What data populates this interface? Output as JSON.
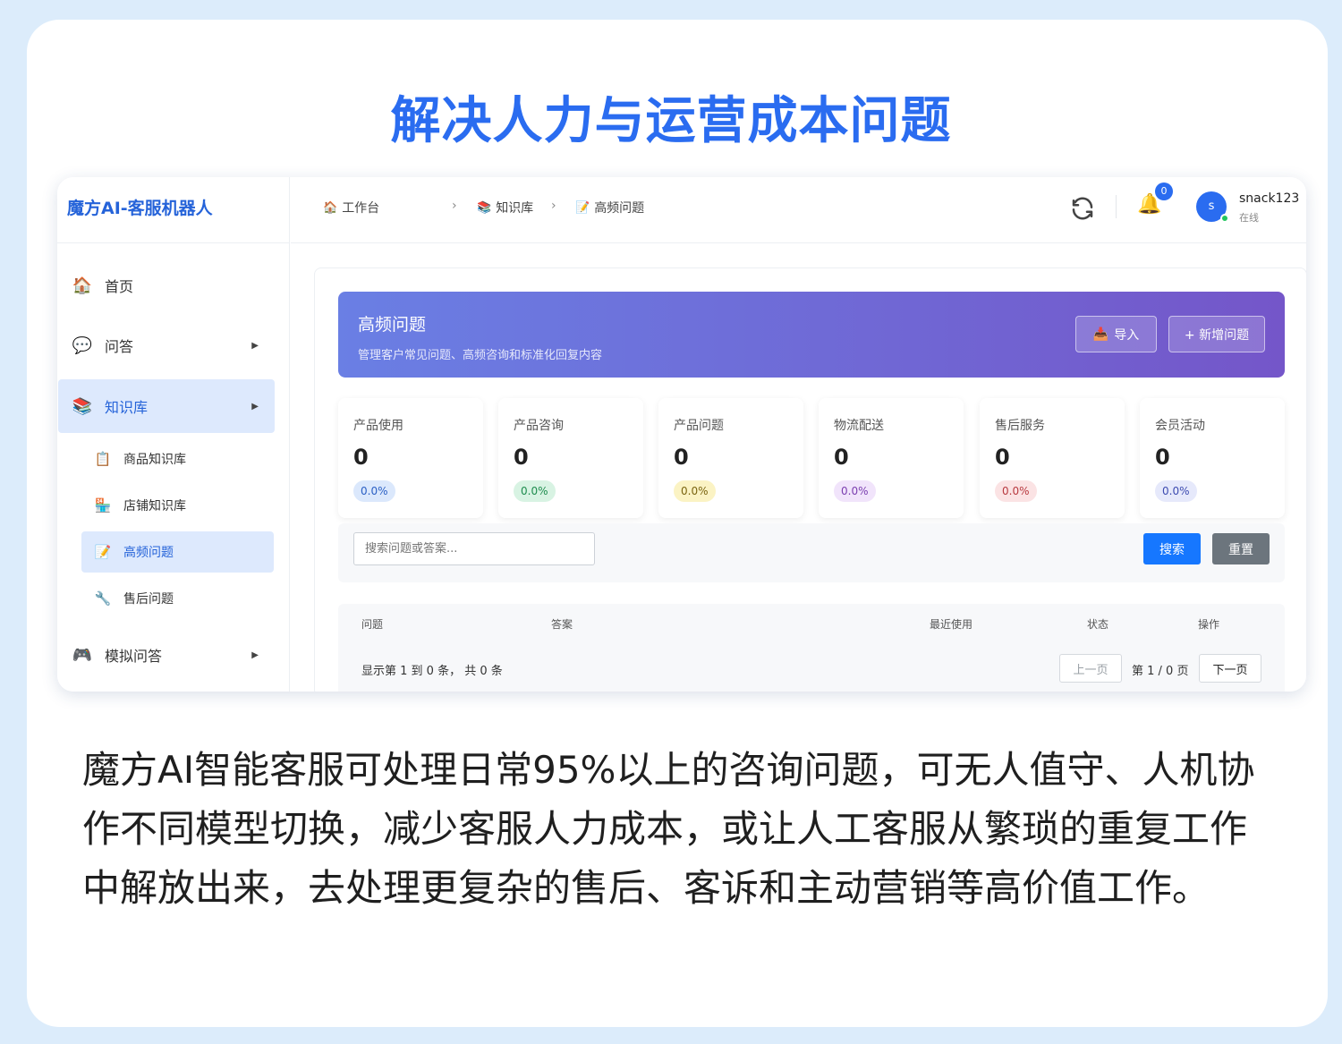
{
  "headline": "解决人力与运营成本问题",
  "app": {
    "brand": "魔方AI-客服机器人",
    "sidebar": {
      "items": [
        {
          "icon": "🏠",
          "label": "首页",
          "arrow": ""
        },
        {
          "icon": "💬",
          "label": "问答",
          "arrow": "▶"
        },
        {
          "icon": "📚",
          "label": "知识库",
          "arrow": "▶"
        },
        {
          "icon": "🎮",
          "label": "模拟问答",
          "arrow": "▶"
        }
      ],
      "sub_items": [
        {
          "icon": "📋",
          "label": "商品知识库"
        },
        {
          "icon": "🏪",
          "label": "店铺知识库"
        },
        {
          "icon": "📝",
          "label": "高频问题"
        },
        {
          "icon": "🔧",
          "label": "售后问题"
        }
      ]
    },
    "topbar": {
      "breadcrumb": [
        {
          "icon": "🏠",
          "label": "工作台"
        },
        {
          "icon": "📚",
          "label": "知识库"
        },
        {
          "icon": "📝",
          "label": "高频问题"
        }
      ],
      "separator": "›",
      "notification_count": "0",
      "bell_icon": "🔔",
      "user": {
        "initial": "s",
        "name": "snack123",
        "status": "在线"
      }
    },
    "banner": {
      "title": "高频问题",
      "subtitle": "管理客户常见问题、高频咨询和标准化回复内容",
      "import_icon": "📥",
      "import_label": "导入",
      "add_label": "+ 新增问题"
    },
    "stats": [
      {
        "label": "产品使用",
        "value": "0",
        "percent": "0.0%",
        "pill_bg": "#dbe8fc",
        "pill_fg": "#2a5fc4"
      },
      {
        "label": "产品咨询",
        "value": "0",
        "percent": "0.0%",
        "pill_bg": "#d8f3e3",
        "pill_fg": "#1e8c4e"
      },
      {
        "label": "产品问题",
        "value": "0",
        "percent": "0.0%",
        "pill_bg": "#fbf3c4",
        "pill_fg": "#7a6410"
      },
      {
        "label": "物流配送",
        "value": "0",
        "percent": "0.0%",
        "pill_bg": "#f1e4fb",
        "pill_fg": "#7b3fb0"
      },
      {
        "label": "售后服务",
        "value": "0",
        "percent": "0.0%",
        "pill_bg": "#fbe3e4",
        "pill_fg": "#b83a40"
      },
      {
        "label": "会员活动",
        "value": "0",
        "percent": "0.0%",
        "pill_bg": "#e6e9fb",
        "pill_fg": "#3d4bb0"
      }
    ],
    "search": {
      "placeholder": "搜索问题或答案...",
      "search_label": "搜索",
      "reset_label": "重置"
    },
    "table": {
      "columns": [
        "问题",
        "答案",
        "最近使用",
        "状态",
        "操作"
      ],
      "info": "显示第 1 到 0 条， 共 0 条",
      "prev_label": "上一页",
      "page_info": "第 1 / 0 页",
      "next_label": "下一页"
    }
  },
  "caption": "魔方AI智能客服可处理日常95%以上的咨询问题，可无人值守、人机协作不同模型切换，减少客服人力成本，或让人工客服从繁琐的重复工作中解放出来，去处理更复杂的售后、客诉和主动营销等高价值工作。",
  "colors": {
    "accent": "#2a6cf0",
    "banner_start": "#6a7fe4",
    "banner_end": "#7456c9",
    "primary_button": "#1677ff",
    "secondary_button": "#6c757d"
  }
}
